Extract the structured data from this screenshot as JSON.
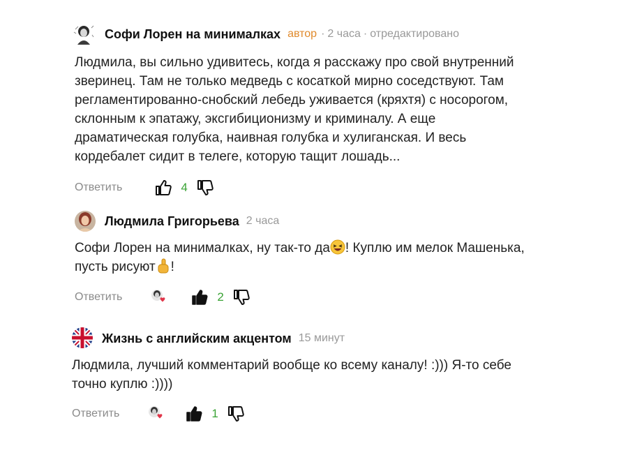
{
  "comments": [
    {
      "author": "Софи Лорен на минималках",
      "badge": "автор",
      "time": "2 часа",
      "edited": "отредактировано",
      "text_lines": [
        "Людмила, вы сильно удивитесь, когда я расскажу про свой внутренний",
        "зверинец. Там не только медведь с косаткой мирно соседствуют. Там",
        "регламентированно-снобский лебедь уживается (кряхтя) с носорогом,",
        "склонным к эпатажу, эксгибиционизму и криминалу. А еще",
        "драматическая голубка, наивная голубка и хулиганская. И весь",
        "кордебалет сидит в телеге, которую тащит лошадь..."
      ],
      "reply": "Ответить",
      "likes": "4",
      "liked": false
    },
    {
      "author": "Людмила Григорьева",
      "time": "2 часа",
      "text_part1": "Софи Лорен на минималках, ну так-то да",
      "text_part2": "! Куплю им мелок Машенька,",
      "text_part3": "пусть рисуют",
      "text_part4": "!",
      "reply": "Ответить",
      "likes": "2",
      "liked": true
    },
    {
      "author": "Жизнь с английским акцентом",
      "time": "15 минут",
      "text_lines": [
        "Людмила, лучший комментарий вообще ко всему каналу! :))) Я-то себе",
        "точно куплю :))))"
      ],
      "reply": "Ответить",
      "likes": "1",
      "liked": true
    }
  ],
  "colors": {
    "author_badge": "#e08a2c",
    "like_count": "#3aa335",
    "muted": "#999999"
  },
  "icons": {
    "like": "thumbs-up-icon",
    "dislike": "thumbs-down-icon",
    "author_liked": "author-heart-icon",
    "laugh_emoji": "laughing-emoji-icon",
    "point_emoji": "pointing-up-emoji-icon"
  }
}
